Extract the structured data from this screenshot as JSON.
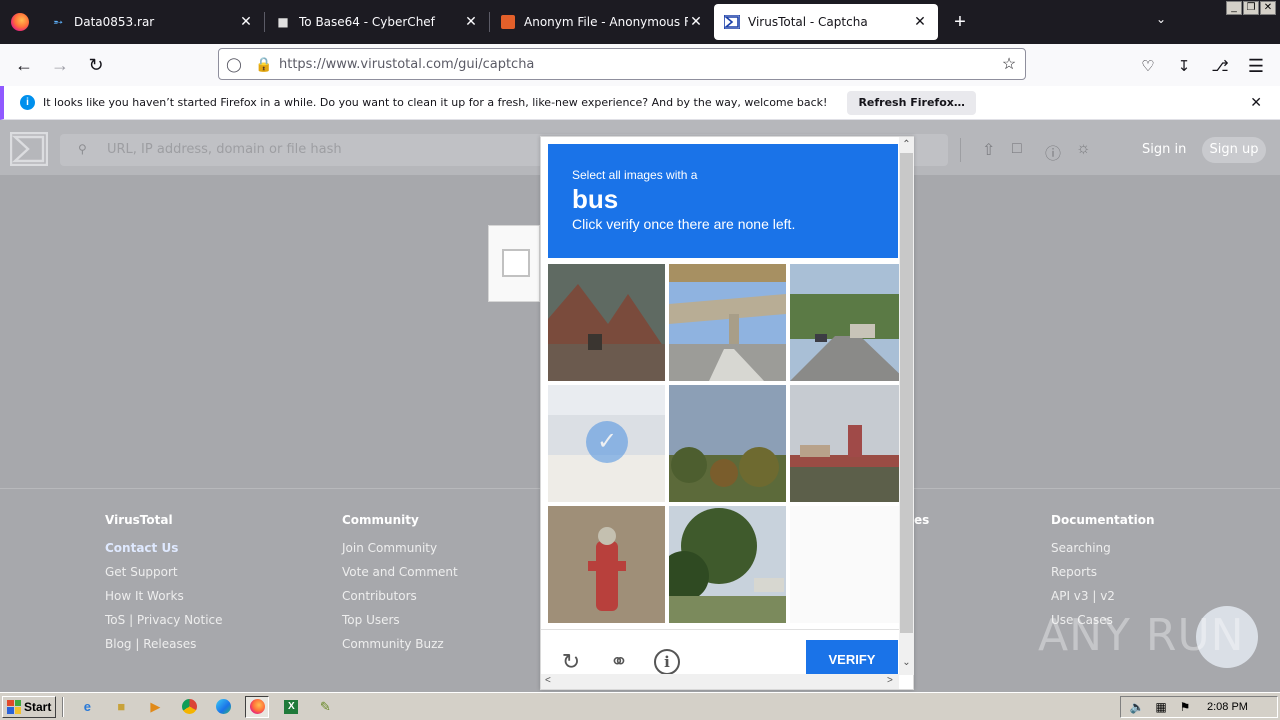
{
  "browser": {
    "tabs": [
      {
        "title": "Data0853.rar",
        "icon": "link-icon",
        "active": false
      },
      {
        "title": "To Base64 - CyberChef",
        "icon": "chef-hat-icon",
        "active": false
      },
      {
        "title": "Anonym File - Anonymous File Uplo",
        "icon": "anonym-file-icon",
        "active": false
      },
      {
        "title": "VirusTotal - Captcha",
        "icon": "virustotal-icon",
        "active": true
      }
    ],
    "url": "https://www.virustotal.com/gui/captcha",
    "notification": {
      "text": "It looks like you haven’t started Firefox in a while. Do you want to clean it up for a fresh, like-new experience? And by the way, welcome back!",
      "button": "Refresh Firefox…"
    }
  },
  "virustotal": {
    "search_placeholder": "URL, IP address, domain or file hash",
    "sign_in": "Sign in",
    "sign_up": "Sign up",
    "footer": {
      "virustotal": {
        "heading": "VirusTotal",
        "links": [
          "Contact Us",
          "Get Support",
          "How It Works",
          "ToS | Privacy Notice",
          "Blog | Releases"
        ]
      },
      "community": {
        "heading": "Community",
        "links": [
          "Join Community",
          "Vote and Comment",
          "Contributors",
          "Top Users",
          "Community Buzz"
        ]
      },
      "tools_partial": {
        "heading": "es"
      },
      "documentation": {
        "heading": "Documentation",
        "links": [
          "Searching",
          "Reports",
          "API v3 | v2",
          "Use Cases"
        ]
      }
    }
  },
  "captcha": {
    "instruction_line1": "Select all images with a",
    "target_word": "bus",
    "instruction_line2": "Click verify once there are none left.",
    "verify_label": "VERIFY",
    "tiles": [
      {
        "name": "house-roof",
        "state": "normal"
      },
      {
        "name": "highway-overpass",
        "state": "normal"
      },
      {
        "name": "street-cars",
        "state": "normal"
      },
      {
        "name": "selected-tile",
        "state": "selected"
      },
      {
        "name": "trees-sky",
        "state": "normal"
      },
      {
        "name": "carnival-scene",
        "state": "normal"
      },
      {
        "name": "fire-hydrant",
        "state": "normal"
      },
      {
        "name": "tree-road",
        "state": "normal"
      },
      {
        "name": "blank-tile",
        "state": "empty"
      }
    ]
  },
  "watermark": "ANY RUN",
  "taskbar": {
    "start_label": "Start",
    "clock": "2:08 PM"
  },
  "colors": {
    "captcha_blue": "#1a73e8",
    "tab_bar": "#1c1b22",
    "page_dim": "#a7a8ac"
  }
}
